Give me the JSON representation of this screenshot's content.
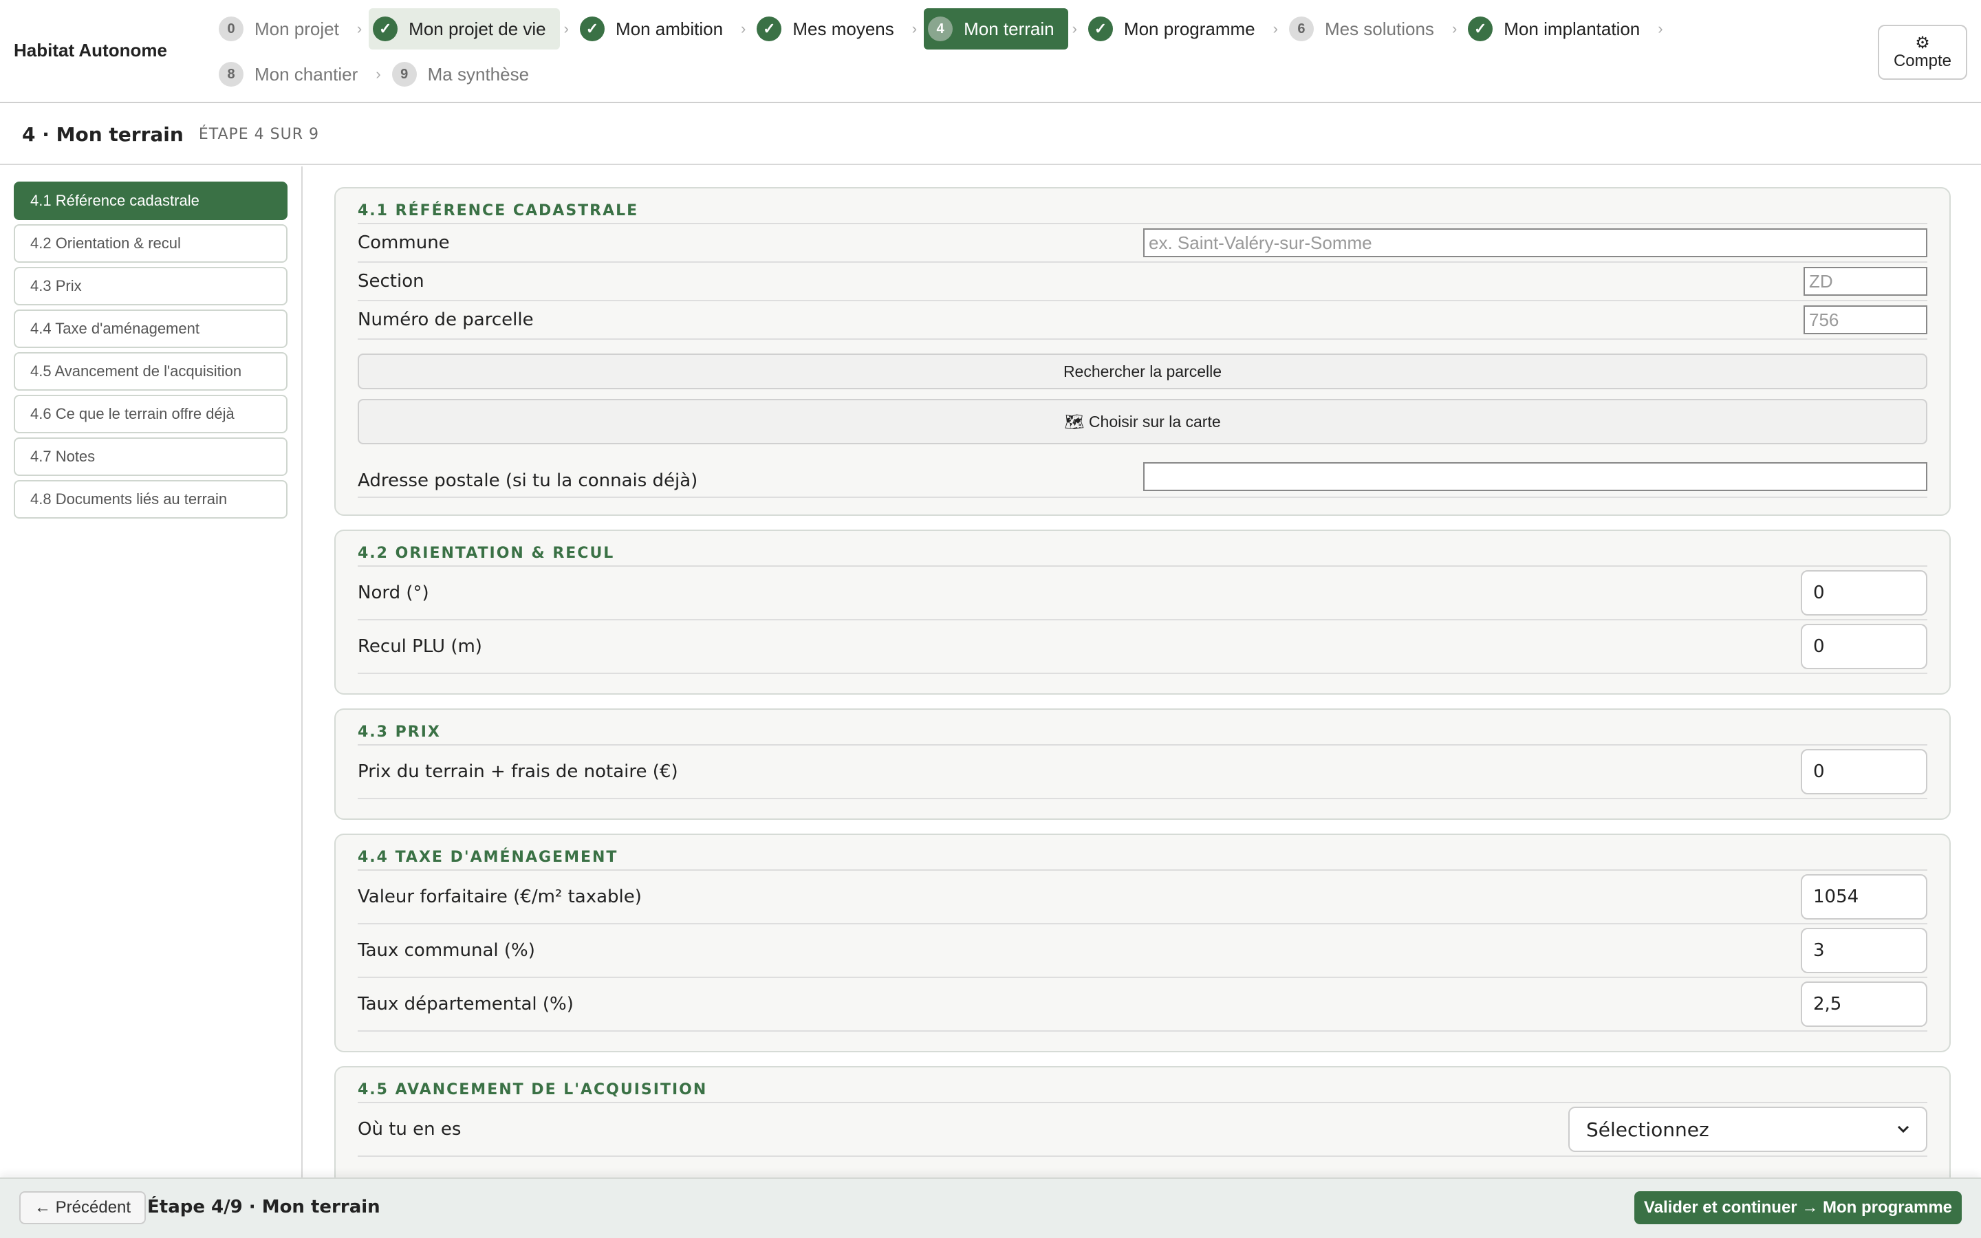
{
  "app": {
    "title": "Habitat Autonome"
  },
  "colors": {
    "accent": "#3a7145",
    "accent_light": "#e6ece4",
    "panel_bg": "#f7f7f5"
  },
  "nav": {
    "steps": [
      {
        "number": "0",
        "label": "Mon projet",
        "status": "todo"
      },
      {
        "number": "✓",
        "label": "Mon projet de vie",
        "status": "done"
      },
      {
        "number": "✓",
        "label": "Mon ambition",
        "status": "done"
      },
      {
        "number": "✓",
        "label": "Mes moyens",
        "status": "done"
      },
      {
        "number": "4",
        "label": "Mon terrain",
        "status": "active"
      },
      {
        "number": "✓",
        "label": "Mon programme",
        "status": "done"
      },
      {
        "number": "6",
        "label": "Mes solutions",
        "status": "todo"
      },
      {
        "number": "✓",
        "label": "Mon implantation",
        "status": "done"
      },
      {
        "number": "8",
        "label": "Mon chantier",
        "status": "todo"
      },
      {
        "number": "9",
        "label": "Ma synthèse",
        "status": "todo"
      }
    ],
    "separator": "›",
    "account": {
      "icon": "gear-icon",
      "glyph": "⚙",
      "label": "Compte"
    }
  },
  "header": {
    "title": "4 · Mon terrain",
    "step_of": "ÉTAPE 4 SUR 9"
  },
  "sidebar": {
    "items": [
      {
        "label": "4.1 Référence cadastrale"
      },
      {
        "label": "4.2 Orientation & recul"
      },
      {
        "label": "4.3 Prix"
      },
      {
        "label": "4.4 Taxe d'aménagement"
      },
      {
        "label": "4.5 Avancement de l'acquisition"
      },
      {
        "label": "4.6 Ce que le terrain offre déjà"
      },
      {
        "label": "4.7 Notes"
      },
      {
        "label": "4.8 Documents liés au terrain"
      }
    ]
  },
  "sections": {
    "cadastre": {
      "title": "4.1 RÉFÉRENCE CADASTRALE",
      "commune": {
        "label": "Commune",
        "placeholder": "ex. Saint-Valéry-sur-Somme",
        "value": ""
      },
      "section": {
        "label": "Section",
        "placeholder": "ZD",
        "value": ""
      },
      "parcelle": {
        "label": "Numéro de parcelle",
        "placeholder": "756",
        "value": ""
      },
      "search_button": "Rechercher la parcelle",
      "map_button": {
        "icon": "map-icon",
        "glyph": "🗺",
        "label": "Choisir sur la carte"
      },
      "adresse": {
        "label": "Adresse postale (si tu la connais déjà)",
        "value": ""
      }
    },
    "orientation": {
      "title": "4.2 ORIENTATION & RECUL",
      "nord": {
        "label": "Nord (°)",
        "value": "0"
      },
      "recul": {
        "label": "Recul PLU (m)",
        "value": "0"
      }
    },
    "prix": {
      "title": "4.3 PRIX",
      "prix": {
        "label": "Prix du terrain + frais de notaire (€)",
        "value": "0"
      }
    },
    "taxe": {
      "title": "4.4 TAXE D'AMÉNAGEMENT",
      "valeur": {
        "label": "Valeur forfaitaire (€/m² taxable)",
        "value": "1054"
      },
      "communal": {
        "label": "Taux communal (%)",
        "value": "3"
      },
      "departemental": {
        "label": "Taux départemental (%)",
        "value": "2,5"
      }
    },
    "avancement": {
      "title": "4.5 AVANCEMENT DE L'ACQUISITION",
      "ou": {
        "label": "Où tu en es",
        "selected": "Sélectionnez",
        "icon": "chevron-down-icon"
      }
    }
  },
  "footer": {
    "prev_label": "← Précédent",
    "status": "Étape 4/9 · Mon terrain",
    "next_label": "Valider et continuer → Mon programme"
  }
}
